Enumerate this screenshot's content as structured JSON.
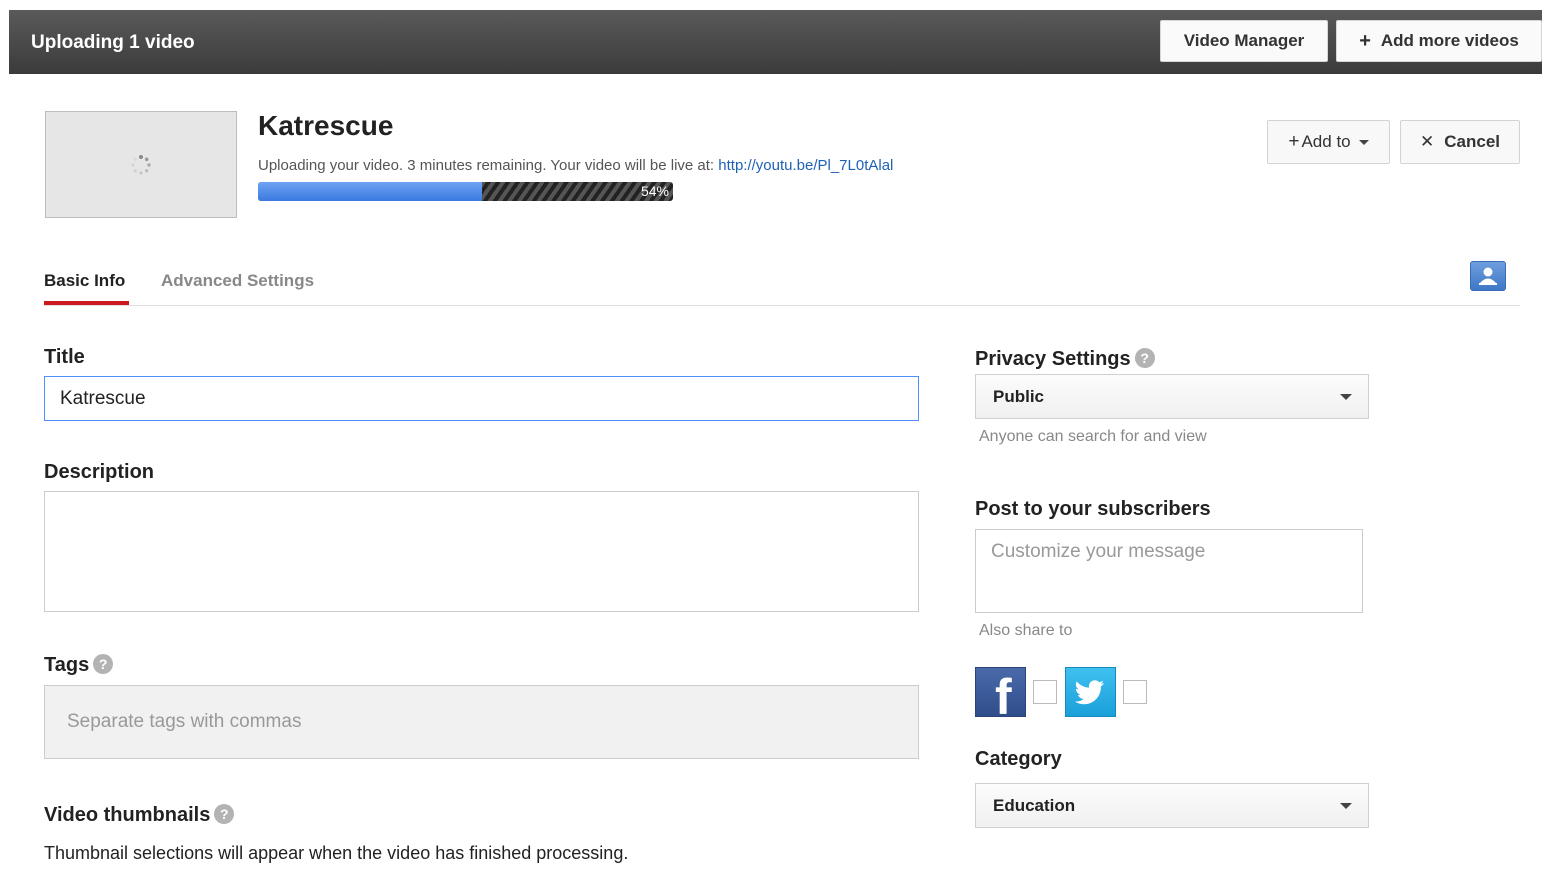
{
  "topbar": {
    "title": "Uploading 1 video",
    "video_manager_label": "Video Manager",
    "add_more_label": "Add more videos",
    "add_more_icon": "+"
  },
  "upload": {
    "video_title": "Katrescue",
    "status_text": "Uploading your video. 3 minutes remaining. Your video will be live at: ",
    "video_url": "http://youtu.be/Pl_7L0tAlal",
    "progress_percent": 54,
    "progress_label": "54%",
    "add_to_label": "Add to",
    "add_to_icon": "+",
    "cancel_label": "Cancel",
    "cancel_icon": "✕"
  },
  "tabs": [
    {
      "label": "Basic Info",
      "active": true
    },
    {
      "label": "Advanced Settings",
      "active": false
    }
  ],
  "form": {
    "title_label": "Title",
    "title_value": "Katrescue",
    "description_label": "Description",
    "description_value": "",
    "tags_label": "Tags",
    "tags_placeholder": "Separate tags with commas",
    "thumbnails_label": "Video thumbnails",
    "thumbnails_note": "Thumbnail selections will appear when the video has finished processing."
  },
  "sidebar": {
    "privacy_label": "Privacy Settings",
    "privacy_value": "Public",
    "privacy_hint": "Anyone can search for and view",
    "post_label": "Post to your subscribers",
    "post_placeholder": "Customize your message",
    "also_share_label": "Also share to",
    "category_label": "Category",
    "category_value": "Education"
  },
  "icons": {
    "help": "?",
    "facebook": "f"
  },
  "colors": {
    "topbar": "#444444",
    "progress_blue": "#4a86e8",
    "tab_underline": "#cc181e",
    "link": "#1f62b5",
    "facebook": "#3b5998",
    "twitter": "#1da1f2"
  }
}
